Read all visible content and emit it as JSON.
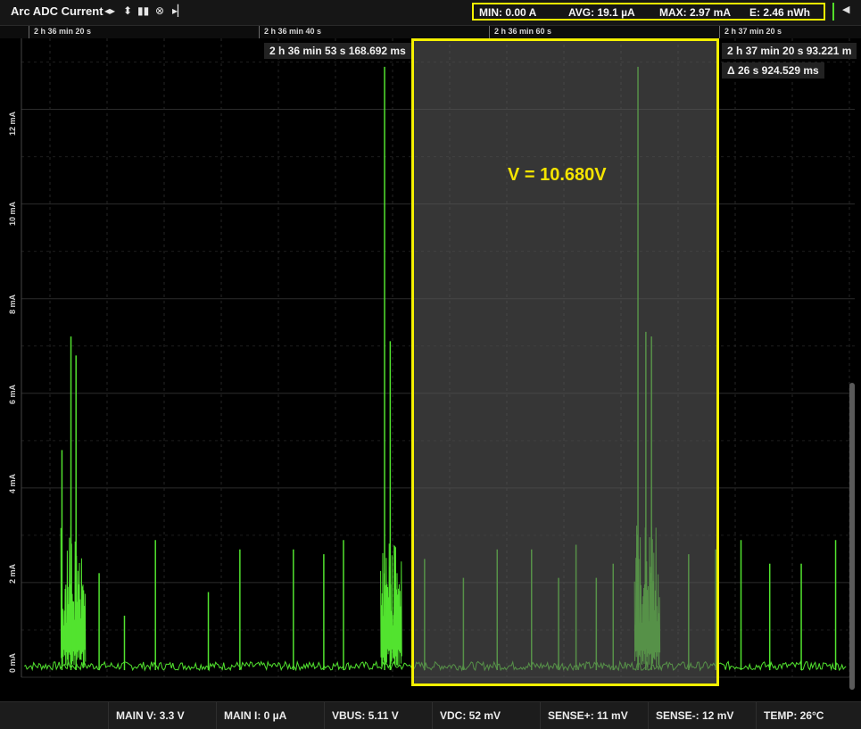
{
  "header": {
    "title": "Arc ADC Current",
    "icons": [
      "pan-arrows-icon",
      "zoom-arrows-icon",
      "pause-icon",
      "clear-icon",
      "play-step-icon"
    ],
    "stats": {
      "min": "MIN: 0.00 A",
      "avg": "AVG: 19.1 µA",
      "max": "MAX: 2.97 mA",
      "energy": "E: 2.46 nWh"
    },
    "collapse_icon": "collapse-left-icon"
  },
  "time_axis": {
    "ticks": [
      "2 h 36 min 20 s",
      "2 h 36 min 40 s",
      "2 h 36 min 60 s",
      "2 h 37 min 20 s"
    ]
  },
  "markers": {
    "start": "2 h 36 min 53 s 168.692 ms",
    "end": "2 h 37 min 20 s 93.221 m",
    "delta": "Δ 26 s 924.529 ms"
  },
  "selection": {
    "voltage": "V = 10.680V"
  },
  "y_axis": {
    "labels": [
      "0 mA",
      "2 mA",
      "4 mA",
      "6 mA",
      "8 mA",
      "10 mA",
      "12 mA"
    ]
  },
  "chart_data": {
    "type": "line",
    "title": "Arc ADC Current",
    "xlabel": "",
    "ylabel": "",
    "ylim": [
      0,
      13.5
    ],
    "x_range_seconds": [
      9360,
      9461
    ],
    "trace_color": "#52e32f",
    "spikes_s_mA": [
      [
        9363.2,
        4.8
      ],
      [
        9364.8,
        7.2
      ],
      [
        9365.7,
        6.8
      ],
      [
        9369.8,
        2.2
      ],
      [
        9374.3,
        1.3
      ],
      [
        9379.8,
        2.9
      ],
      [
        9389.2,
        1.8
      ],
      [
        9394.8,
        2.7
      ],
      [
        9404.3,
        2.7
      ],
      [
        9409.7,
        2.6
      ],
      [
        9413.2,
        2.9
      ],
      [
        9420.5,
        12.9
      ],
      [
        9421.5,
        7.1
      ],
      [
        9427.6,
        2.5
      ],
      [
        9434.5,
        2.1
      ],
      [
        9440.5,
        2.7
      ],
      [
        9446.6,
        2.7
      ],
      [
        9451.4,
        2.1
      ],
      [
        9454.5,
        2.8
      ],
      [
        9458.1,
        2.1
      ],
      [
        9461.1,
        2.4
      ],
      [
        9465.5,
        12.9
      ],
      [
        9466.9,
        7.3
      ],
      [
        9467.9,
        7.2
      ],
      [
        9474.5,
        2.6
      ],
      [
        9479.3,
        2.7
      ],
      [
        9483.8,
        2.9
      ],
      [
        9488.9,
        2.4
      ],
      [
        9494.5,
        2.4
      ],
      [
        9500.6,
        2.9
      ]
    ],
    "bursts_s_mA": [
      [
        9363.0,
        9367.4,
        3.3
      ],
      [
        9419.8,
        9423.6,
        3.3
      ],
      [
        9464.9,
        9469.4,
        3.3
      ]
    ],
    "baseline_mA": 0.15,
    "selection_s": [
      9413.17,
      9440.09
    ]
  },
  "footer": {
    "main_v": "MAIN V: 3.3 V",
    "main_i": "MAIN I: 0 µA",
    "vbus": "VBUS: 5.11 V",
    "vdc": "VDC: 52 mV",
    "sense_plus": "SENSE+: 11 mV",
    "sense_minus": "SENSE-: 12 mV",
    "temp": "TEMP: 26°C"
  }
}
